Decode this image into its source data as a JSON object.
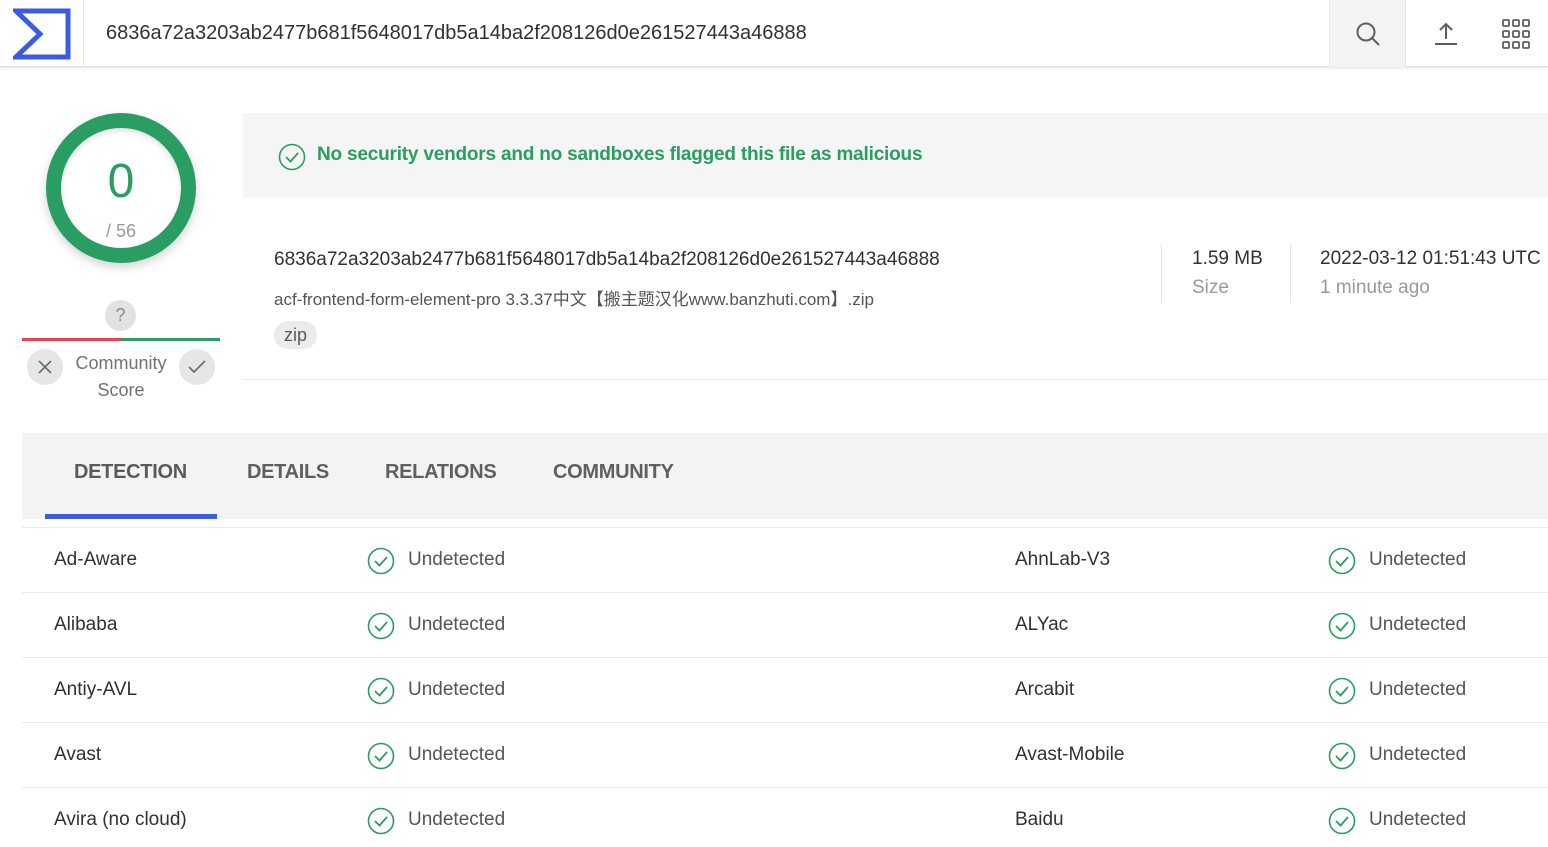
{
  "header": {
    "search_value": "6836a72a3203ab2477b681f5648017db5a14ba2f208126d0e261527443a46888",
    "logo_icon": "virustotal-logo-icon",
    "search_icon": "search-icon",
    "upload_icon": "upload-icon",
    "apps_icon": "apps-grid-icon",
    "brand_color": "#3b5be0"
  },
  "score": {
    "detections": "0",
    "total": "/ 56",
    "color": "#2a9d62",
    "community_question": "?",
    "community_label_1": "Community",
    "community_label_2": "Score"
  },
  "banner": {
    "text": "No security vendors and no sandboxes flagged this file as malicious",
    "icon": "check-circle-icon"
  },
  "file": {
    "hash": "6836a72a3203ab2477b681f5648017db5a14ba2f208126d0e261527443a46888",
    "name": "acf-frontend-form-element-pro 3.3.37中文【搬主题汉化www.banzhuti.com】.zip",
    "tag": "zip",
    "size_value": "1.59 MB",
    "size_label": "Size",
    "date_value": "2022-03-12 01:51:43 UTC",
    "date_relative": "1 minute ago"
  },
  "tabs": [
    {
      "label": "DETECTION",
      "active": true
    },
    {
      "label": "DETAILS",
      "active": false
    },
    {
      "label": "RELATIONS",
      "active": false
    },
    {
      "label": "COMMUNITY",
      "active": false
    }
  ],
  "detections": [
    {
      "left_vendor": "Ad-Aware",
      "left_status": "Undetected",
      "right_vendor": "AhnLab-V3",
      "right_status": "Undetected"
    },
    {
      "left_vendor": "Alibaba",
      "left_status": "Undetected",
      "right_vendor": "ALYac",
      "right_status": "Undetected"
    },
    {
      "left_vendor": "Antiy-AVL",
      "left_status": "Undetected",
      "right_vendor": "Arcabit",
      "right_status": "Undetected"
    },
    {
      "left_vendor": "Avast",
      "left_status": "Undetected",
      "right_vendor": "Avast-Mobile",
      "right_status": "Undetected"
    },
    {
      "left_vendor": "Avira (no cloud)",
      "left_status": "Undetected",
      "right_vendor": "Baidu",
      "right_status": "Undetected"
    }
  ]
}
